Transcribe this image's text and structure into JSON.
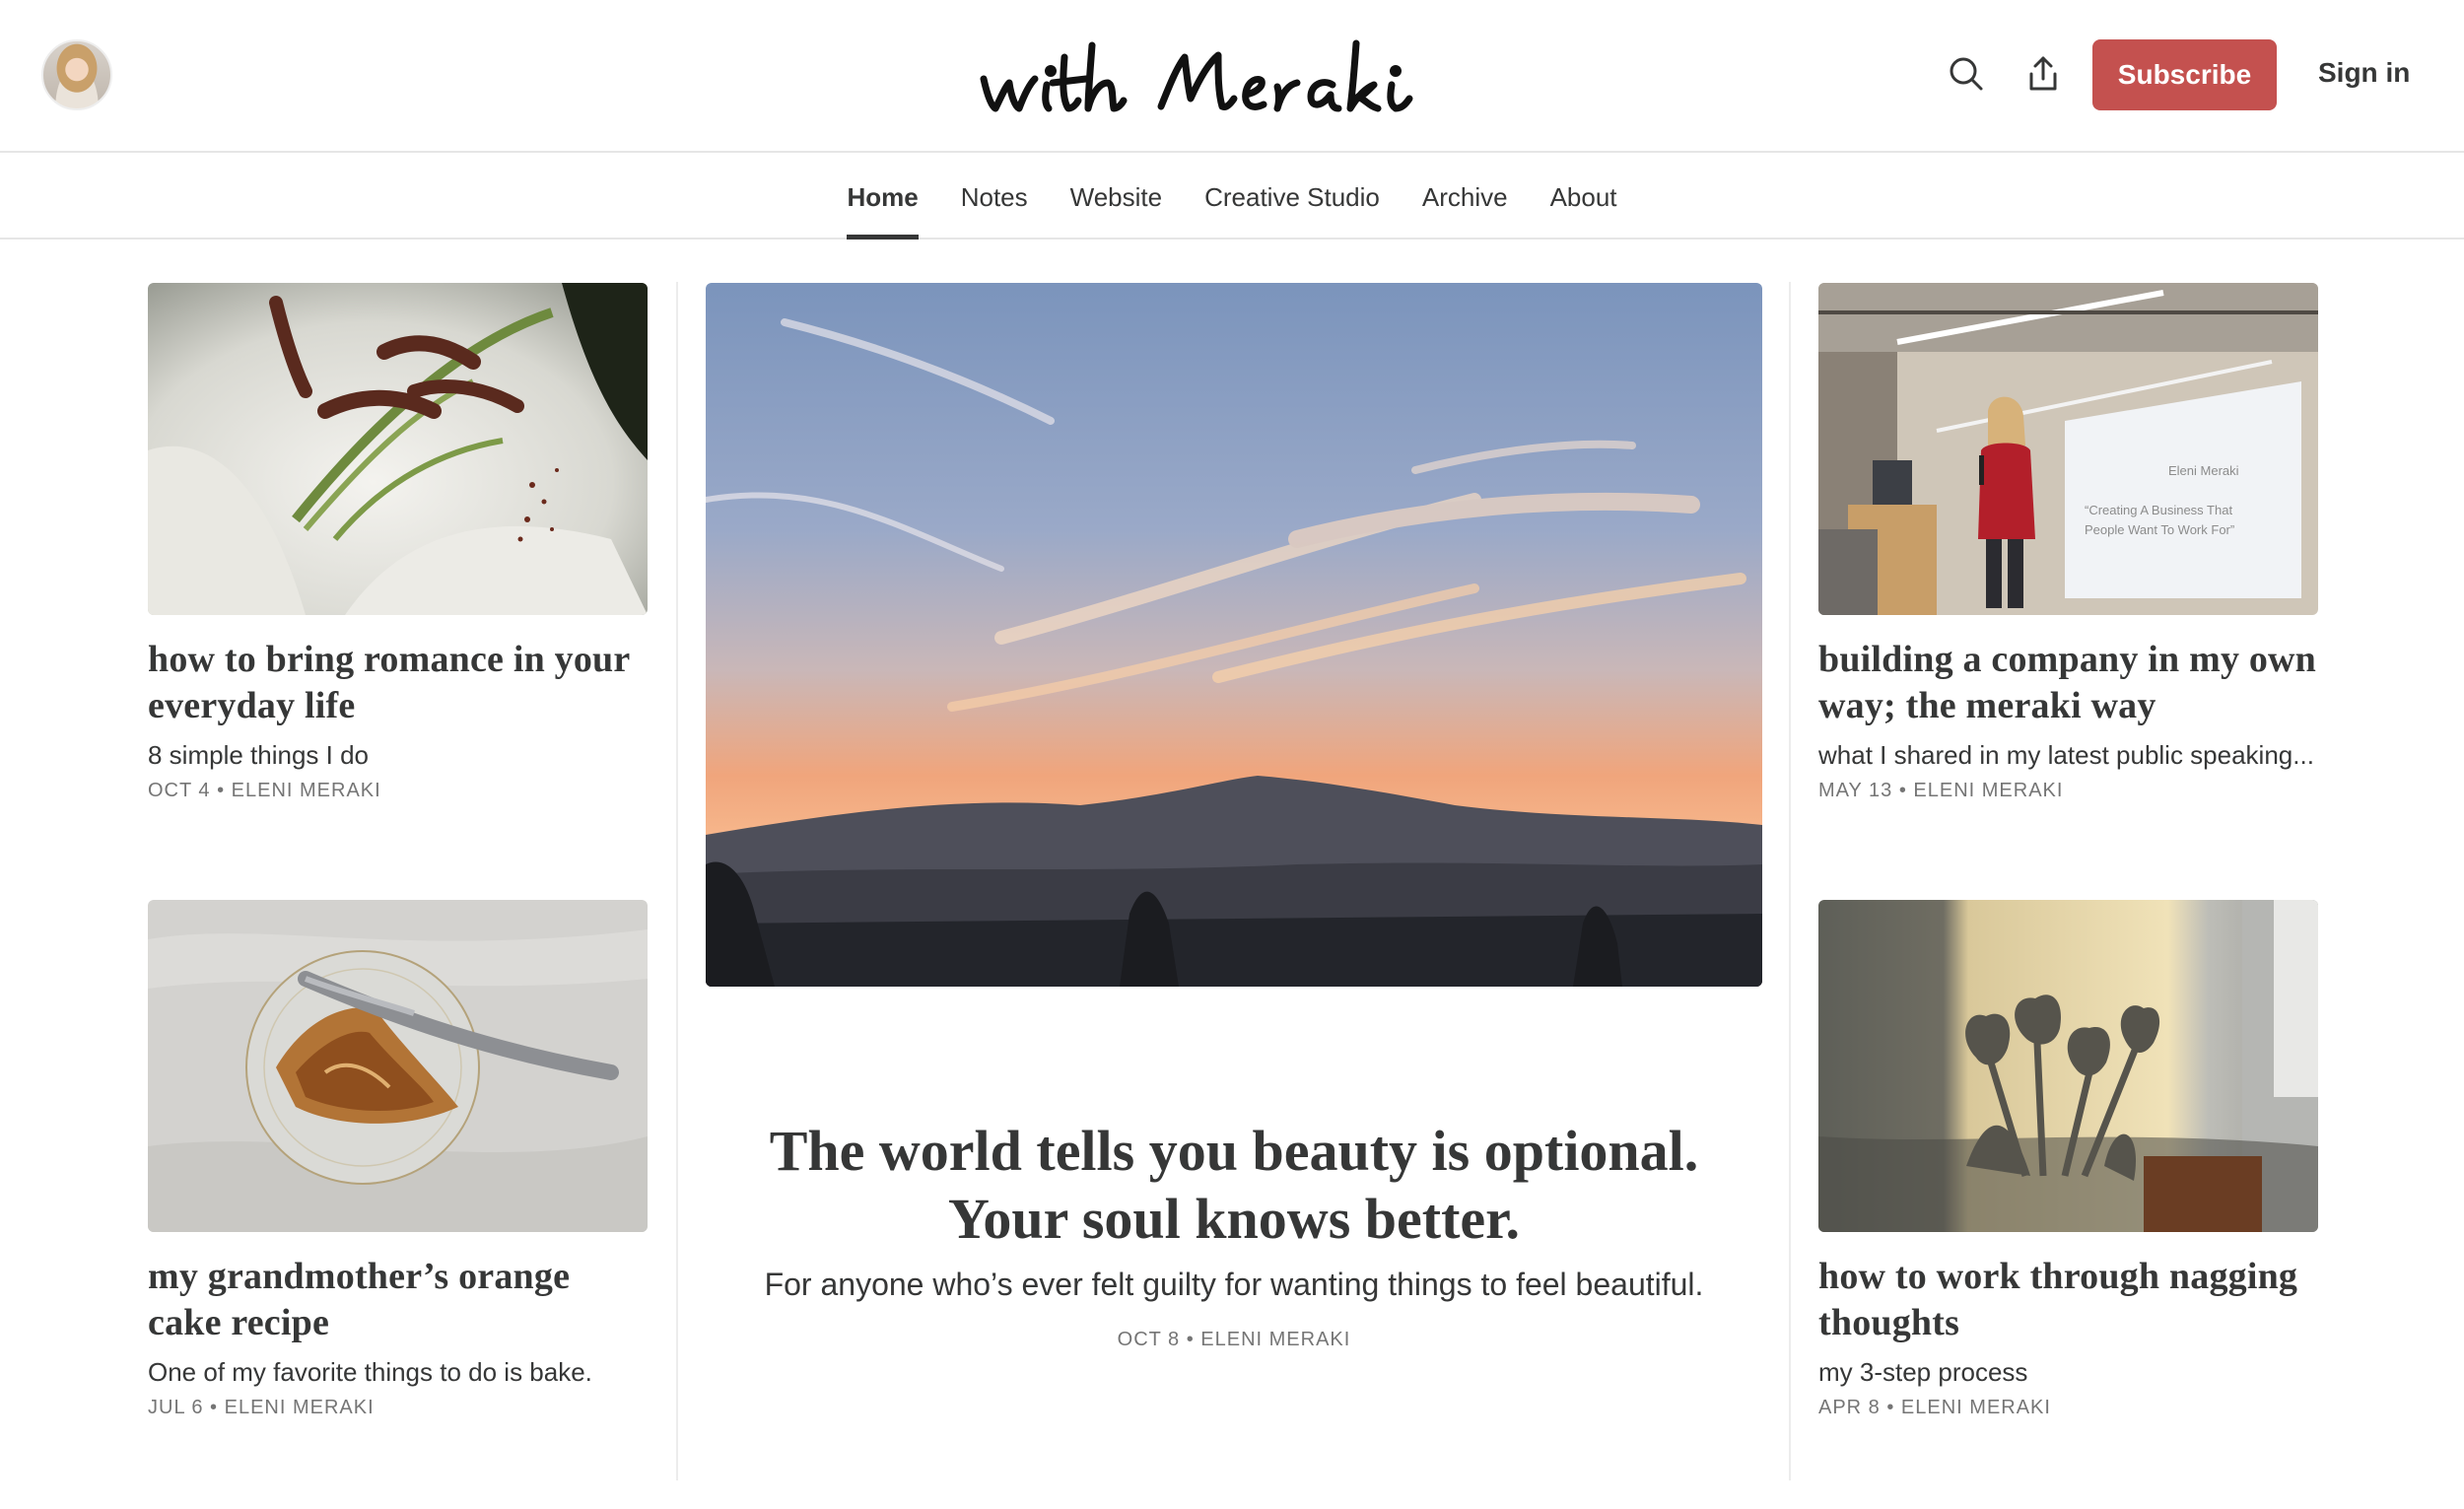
{
  "header": {
    "logo_text": "with Meraki",
    "subscribe_label": "Subscribe",
    "signin_label": "Sign in"
  },
  "nav": {
    "items": [
      {
        "label": "Home",
        "active": true
      },
      {
        "label": "Notes",
        "active": false
      },
      {
        "label": "Website",
        "active": false
      },
      {
        "label": "Creative Studio",
        "active": false
      },
      {
        "label": "Archive",
        "active": false
      },
      {
        "label": "About",
        "active": false
      }
    ]
  },
  "featured": {
    "title": "The world tells you beauty is optional. Your soul knows better.",
    "subtitle": "For anyone who’s ever felt guilty for wanting things to feel beautiful.",
    "meta": "OCT 8 • ELENI MERAKI"
  },
  "posts": [
    {
      "title": "how to bring romance in your everyday life",
      "subtitle": "8 simple things I do",
      "meta": "OCT 4 • ELENI MERAKI"
    },
    {
      "title": "my grandmother’s orange cake recipe",
      "subtitle": "One of my favorite things to do is bake.",
      "meta": "JUL 6 • ELENI MERAKI"
    },
    {
      "title": "building a company in my own way; the meraki way",
      "subtitle": "what I shared in my latest public speaking...",
      "meta": "MAY 13 • ELENI MERAKI"
    },
    {
      "title": "how to work through nagging thoughts",
      "subtitle": "my 3-step process",
      "meta": "APR 8 • ELENI MERAKI"
    }
  ],
  "slide": {
    "name": "Eleni Meraki",
    "line1": "“Creating A Business That",
    "line2": "People Want To Work For”"
  },
  "colors": {
    "accent": "#c4514f",
    "text": "#363737",
    "meta": "#757575"
  },
  "icons": {
    "search": "search-icon",
    "share": "share-icon"
  }
}
